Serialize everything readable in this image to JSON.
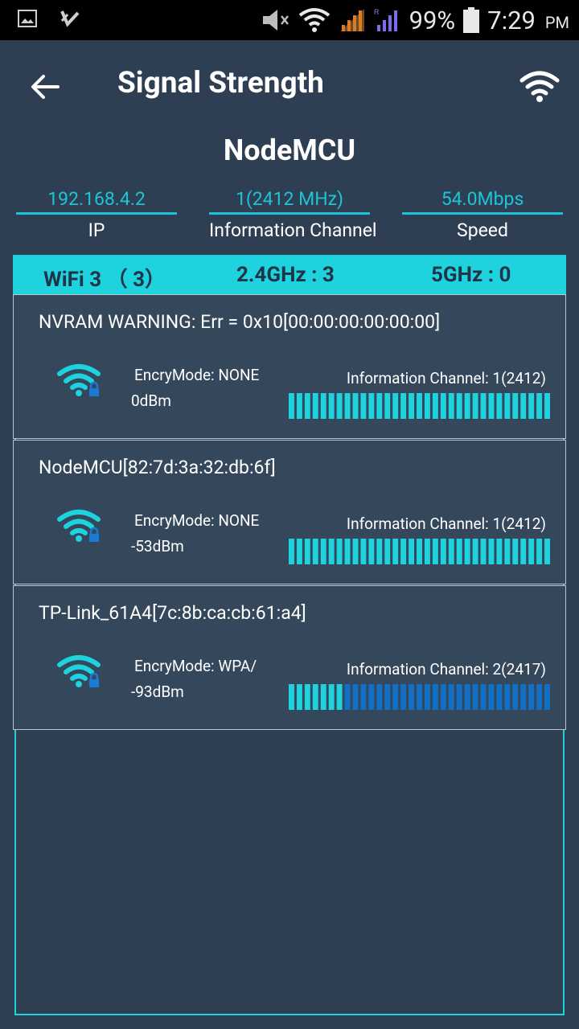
{
  "status_bar": {
    "battery": "99%",
    "time": "7:29",
    "ampm": "PM"
  },
  "toolbar": {
    "title": "Signal Strength"
  },
  "current": {
    "name": "NodeMCU",
    "ip": "192.168.4.2",
    "ip_label": "IP",
    "channel": "1(2412 MHz)",
    "channel_label": "Information Channel",
    "speed": "54.0Mbps",
    "speed_label": "Speed"
  },
  "tabs": {
    "wifi": "WiFi 3 （ 3）",
    "band24": "2.4GHz : 3",
    "band5": "5GHz : 0"
  },
  "networks": [
    {
      "title": "NVRAM WARNING: Err = 0x10[00:00:00:00:00:00]",
      "encryption": "EncryMode: NONE",
      "signal": "0dBm",
      "channel": "Information Channel: 1(2412)",
      "strength_fraction": 1.0
    },
    {
      "title": "NodeMCU[82:7d:3a:32:db:6f]",
      "encryption": "EncryMode: NONE",
      "signal": "-53dBm",
      "channel": "Information Channel: 1(2412)",
      "strength_fraction": 1.0
    },
    {
      "title": "TP-Link_61A4[7c:8b:ca:cb:61:a4]",
      "encryption": "EncryMode: WPA/",
      "signal": "-93dBm",
      "channel": "Information Channel: 2(2417)",
      "strength_fraction": 0.21
    }
  ],
  "colors": {
    "background": "#2f3f53",
    "accent": "#1ed2de",
    "bar_active": "#1ed2de",
    "bar_inactive": "#1170c6",
    "lock": "#1a7bd6"
  },
  "icons": {
    "back": "back-arrow-icon",
    "wifi": "wifi-icon",
    "network": "wifi-lock-icon"
  }
}
